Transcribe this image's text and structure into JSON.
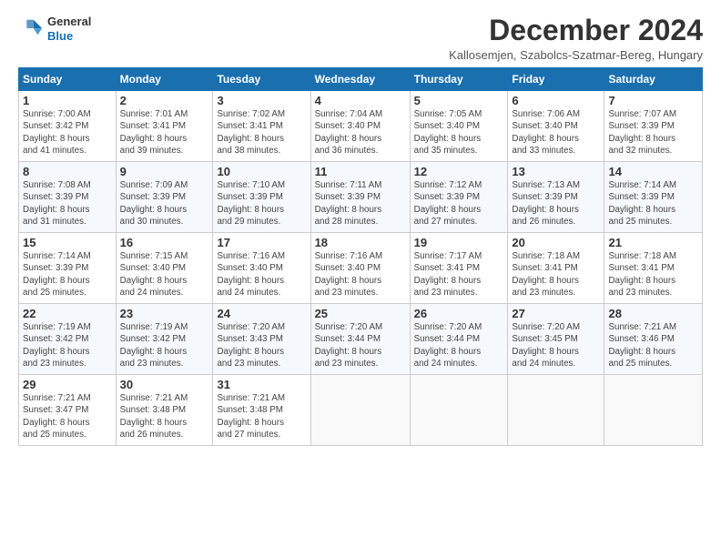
{
  "logo": {
    "general": "General",
    "blue": "Blue"
  },
  "header": {
    "title": "December 2024",
    "subtitle": "Kallosemjen, Szabolcs-Szatmar-Bereg, Hungary"
  },
  "weekdays": [
    "Sunday",
    "Monday",
    "Tuesday",
    "Wednesday",
    "Thursday",
    "Friday",
    "Saturday"
  ],
  "weeks": [
    [
      {
        "day": "1",
        "info": "Sunrise: 7:00 AM\nSunset: 3:42 PM\nDaylight: 8 hours\nand 41 minutes."
      },
      {
        "day": "2",
        "info": "Sunrise: 7:01 AM\nSunset: 3:41 PM\nDaylight: 8 hours\nand 39 minutes."
      },
      {
        "day": "3",
        "info": "Sunrise: 7:02 AM\nSunset: 3:41 PM\nDaylight: 8 hours\nand 38 minutes."
      },
      {
        "day": "4",
        "info": "Sunrise: 7:04 AM\nSunset: 3:40 PM\nDaylight: 8 hours\nand 36 minutes."
      },
      {
        "day": "5",
        "info": "Sunrise: 7:05 AM\nSunset: 3:40 PM\nDaylight: 8 hours\nand 35 minutes."
      },
      {
        "day": "6",
        "info": "Sunrise: 7:06 AM\nSunset: 3:40 PM\nDaylight: 8 hours\nand 33 minutes."
      },
      {
        "day": "7",
        "info": "Sunrise: 7:07 AM\nSunset: 3:39 PM\nDaylight: 8 hours\nand 32 minutes."
      }
    ],
    [
      {
        "day": "8",
        "info": "Sunrise: 7:08 AM\nSunset: 3:39 PM\nDaylight: 8 hours\nand 31 minutes."
      },
      {
        "day": "9",
        "info": "Sunrise: 7:09 AM\nSunset: 3:39 PM\nDaylight: 8 hours\nand 30 minutes."
      },
      {
        "day": "10",
        "info": "Sunrise: 7:10 AM\nSunset: 3:39 PM\nDaylight: 8 hours\nand 29 minutes."
      },
      {
        "day": "11",
        "info": "Sunrise: 7:11 AM\nSunset: 3:39 PM\nDaylight: 8 hours\nand 28 minutes."
      },
      {
        "day": "12",
        "info": "Sunrise: 7:12 AM\nSunset: 3:39 PM\nDaylight: 8 hours\nand 27 minutes."
      },
      {
        "day": "13",
        "info": "Sunrise: 7:13 AM\nSunset: 3:39 PM\nDaylight: 8 hours\nand 26 minutes."
      },
      {
        "day": "14",
        "info": "Sunrise: 7:14 AM\nSunset: 3:39 PM\nDaylight: 8 hours\nand 25 minutes."
      }
    ],
    [
      {
        "day": "15",
        "info": "Sunrise: 7:14 AM\nSunset: 3:39 PM\nDaylight: 8 hours\nand 25 minutes."
      },
      {
        "day": "16",
        "info": "Sunrise: 7:15 AM\nSunset: 3:40 PM\nDaylight: 8 hours\nand 24 minutes."
      },
      {
        "day": "17",
        "info": "Sunrise: 7:16 AM\nSunset: 3:40 PM\nDaylight: 8 hours\nand 24 minutes."
      },
      {
        "day": "18",
        "info": "Sunrise: 7:16 AM\nSunset: 3:40 PM\nDaylight: 8 hours\nand 23 minutes."
      },
      {
        "day": "19",
        "info": "Sunrise: 7:17 AM\nSunset: 3:41 PM\nDaylight: 8 hours\nand 23 minutes."
      },
      {
        "day": "20",
        "info": "Sunrise: 7:18 AM\nSunset: 3:41 PM\nDaylight: 8 hours\nand 23 minutes."
      },
      {
        "day": "21",
        "info": "Sunrise: 7:18 AM\nSunset: 3:41 PM\nDaylight: 8 hours\nand 23 minutes."
      }
    ],
    [
      {
        "day": "22",
        "info": "Sunrise: 7:19 AM\nSunset: 3:42 PM\nDaylight: 8 hours\nand 23 minutes."
      },
      {
        "day": "23",
        "info": "Sunrise: 7:19 AM\nSunset: 3:42 PM\nDaylight: 8 hours\nand 23 minutes."
      },
      {
        "day": "24",
        "info": "Sunrise: 7:20 AM\nSunset: 3:43 PM\nDaylight: 8 hours\nand 23 minutes."
      },
      {
        "day": "25",
        "info": "Sunrise: 7:20 AM\nSunset: 3:44 PM\nDaylight: 8 hours\nand 23 minutes."
      },
      {
        "day": "26",
        "info": "Sunrise: 7:20 AM\nSunset: 3:44 PM\nDaylight: 8 hours\nand 24 minutes."
      },
      {
        "day": "27",
        "info": "Sunrise: 7:20 AM\nSunset: 3:45 PM\nDaylight: 8 hours\nand 24 minutes."
      },
      {
        "day": "28",
        "info": "Sunrise: 7:21 AM\nSunset: 3:46 PM\nDaylight: 8 hours\nand 25 minutes."
      }
    ],
    [
      {
        "day": "29",
        "info": "Sunrise: 7:21 AM\nSunset: 3:47 PM\nDaylight: 8 hours\nand 25 minutes."
      },
      {
        "day": "30",
        "info": "Sunrise: 7:21 AM\nSunset: 3:48 PM\nDaylight: 8 hours\nand 26 minutes."
      },
      {
        "day": "31",
        "info": "Sunrise: 7:21 AM\nSunset: 3:48 PM\nDaylight: 8 hours\nand 27 minutes."
      },
      null,
      null,
      null,
      null
    ]
  ]
}
